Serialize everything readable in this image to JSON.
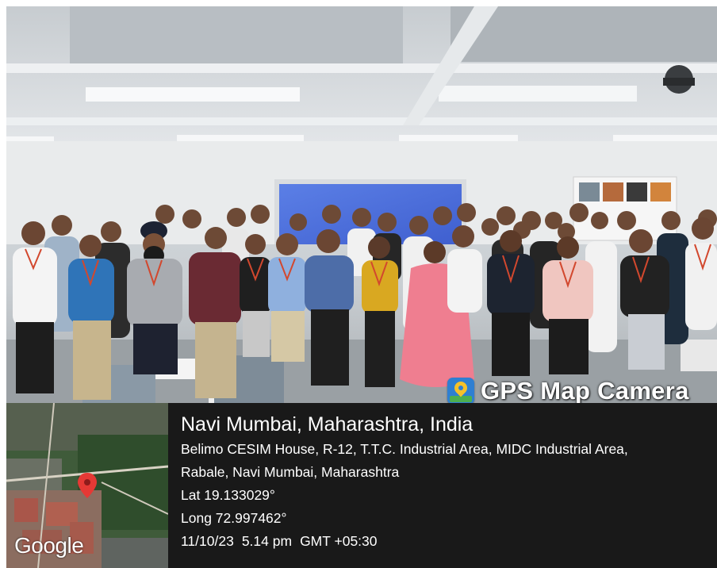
{
  "image": {
    "description_icon": "group-photo",
    "accent_colors": {
      "overlay": "#121212",
      "gps_logo": "#2f7fd2",
      "pin": "#e53935"
    }
  },
  "stamp": {
    "app_name": "GPS Map Camera",
    "location_title": "Navi Mumbai, Maharashtra, India",
    "address_line1": "Belimo CESIM House, R-12, T.T.C. Industrial Area, MIDC Industrial Area,",
    "address_line2": "Rabale, Navi Mumbai, Maharashtra",
    "latitude": "Lat 19.133029°",
    "longitude": "Long 72.997462°",
    "date": "11/10/23",
    "time": "5.14 pm",
    "timezone": "GMT +05:30"
  },
  "map": {
    "provider_logo": "Google",
    "marker_icon": "map-pin-icon"
  }
}
